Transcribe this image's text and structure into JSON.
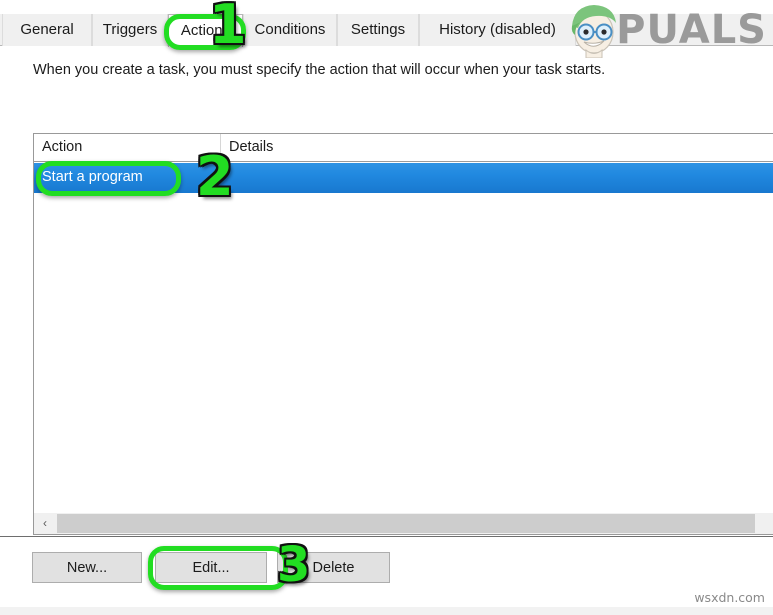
{
  "window": {
    "tabs": [
      {
        "label": "General",
        "active": false
      },
      {
        "label": "Triggers",
        "active": false
      },
      {
        "label": "Actions",
        "active": true
      },
      {
        "label": "Conditions",
        "active": false
      },
      {
        "label": "Settings",
        "active": false
      },
      {
        "label": "History (disabled)",
        "active": false
      }
    ],
    "description": "When you create a task, you must specify the action that will occur when your task starts."
  },
  "action_list": {
    "columns": [
      {
        "label": "Action"
      },
      {
        "label": "Details"
      }
    ],
    "rows": [
      {
        "action": "Start a program",
        "details": "",
        "selected": true
      }
    ]
  },
  "scrollbar": {
    "left_arrow_glyph": "‹"
  },
  "buttons": {
    "new": "New...",
    "edit": "Edit...",
    "delete": "Delete"
  },
  "annotations": [
    {
      "number": "1",
      "target": "actions-tab"
    },
    {
      "number": "2",
      "target": "start-a-program-row"
    },
    {
      "number": "3",
      "target": "edit-button"
    }
  ],
  "watermarks": {
    "brand": "PUALS",
    "brand_full": "APPUALS",
    "site": "wsxdn.com"
  },
  "colors": {
    "selection_blue": "#2189e0",
    "annotation_green": "#22dd22",
    "window_face": "#f0f0f0",
    "button_face": "#e1e1e1"
  }
}
